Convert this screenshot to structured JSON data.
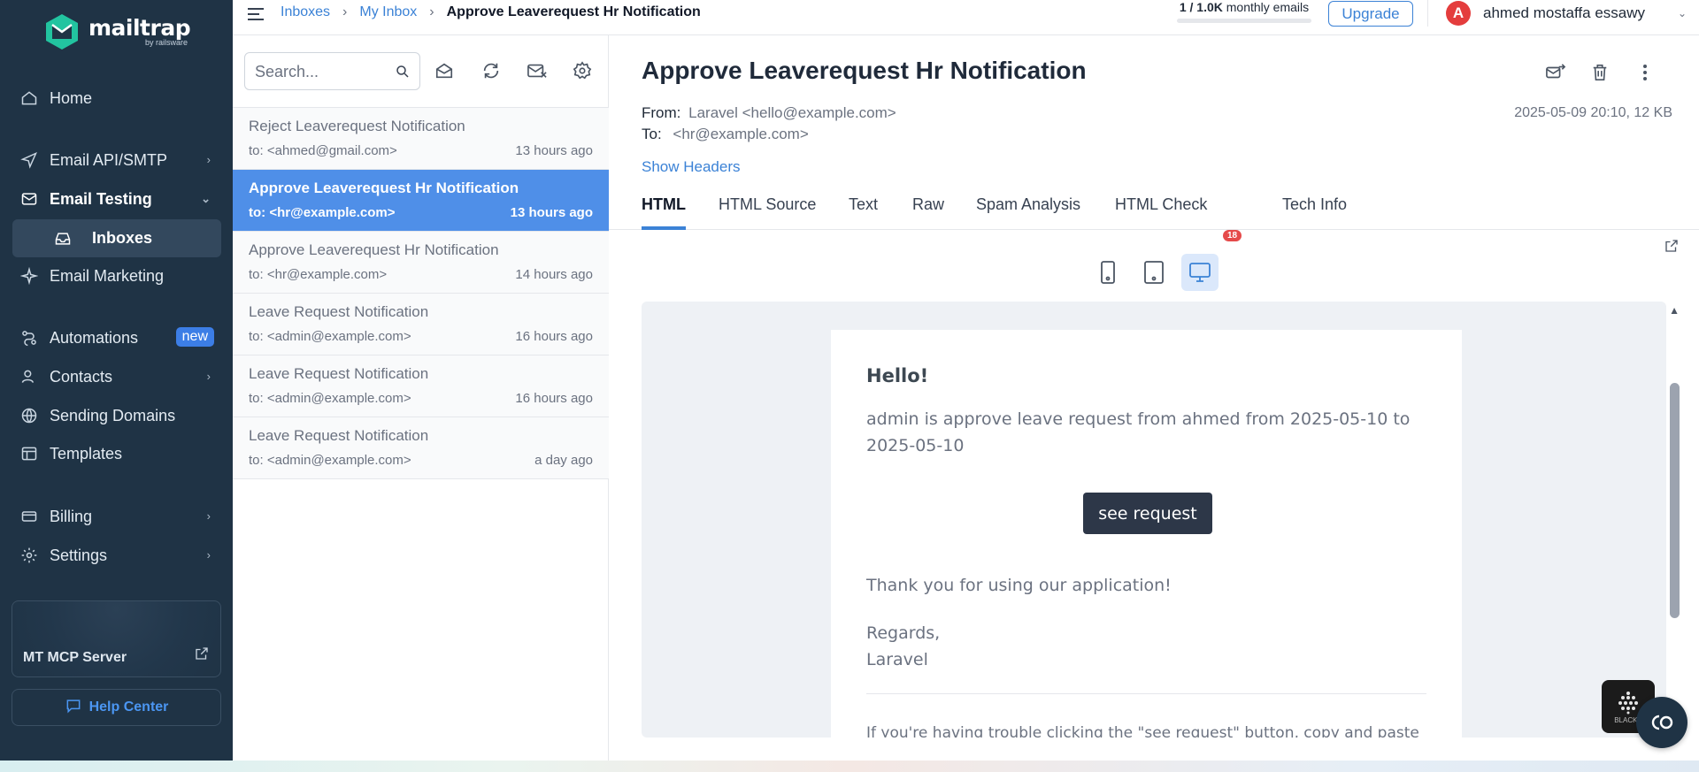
{
  "brand": {
    "name": "mailtrap",
    "sub": "by railsware",
    "color": "#1f3345",
    "accent": "#3b82d6"
  },
  "sidebar": {
    "items": [
      {
        "label": "Home",
        "icon": "home-icon"
      },
      {
        "label": "Email API/SMTP",
        "icon": "send-icon"
      },
      {
        "label": "Email Testing",
        "icon": "email-testing-icon"
      },
      {
        "label": "Inboxes",
        "icon": "inbox-icon"
      },
      {
        "label": "Email Marketing",
        "icon": "sparkle-icon"
      },
      {
        "label": "Automations",
        "icon": "automation-icon",
        "badge": "new"
      },
      {
        "label": "Contacts",
        "icon": "contacts-icon"
      },
      {
        "label": "Sending Domains",
        "icon": "globe-icon"
      },
      {
        "label": "Templates",
        "icon": "templates-icon"
      },
      {
        "label": "Billing",
        "icon": "billing-icon"
      },
      {
        "label": "Settings",
        "icon": "settings-icon"
      }
    ],
    "mcp": {
      "title": "MT MCP Server"
    },
    "help": {
      "label": "Help Center"
    }
  },
  "topbar": {
    "breadcrumbs": [
      "Inboxes",
      "My Inbox",
      "Approve Leaverequest Hr Notification"
    ],
    "usage_value": "1 / 1.0K",
    "usage_label": "monthly emails",
    "usage_fraction": 0.001,
    "upgrade": "Upgrade",
    "avatar_initial": "A",
    "user_name": "ahmed mostaffa essawy"
  },
  "list": {
    "search_placeholder": "Search...",
    "messages": [
      {
        "subject": "Reject Leaverequest Notification",
        "to": "to: <ahmed@gmail.com>",
        "time": "13 hours ago",
        "selected": false
      },
      {
        "subject": "Approve Leaverequest Hr Notification",
        "to": "to: <hr@example.com>",
        "time": "13 hours ago",
        "selected": true
      },
      {
        "subject": "Approve Leaverequest Hr Notification",
        "to": "to: <hr@example.com>",
        "time": "14 hours ago",
        "selected": false
      },
      {
        "subject": "Leave Request Notification",
        "to": "to: <admin@example.com>",
        "time": "16 hours ago",
        "selected": false
      },
      {
        "subject": "Leave Request Notification",
        "to": "to: <admin@example.com>",
        "time": "16 hours ago",
        "selected": false
      },
      {
        "subject": "Leave Request Notification",
        "to": "to: <admin@example.com>",
        "time": "a day ago",
        "selected": false
      }
    ]
  },
  "detail": {
    "subject": "Approve Leaverequest Hr Notification",
    "from_label": "From:",
    "from_value": "Laravel <hello@example.com>",
    "to_label": "To:",
    "to_value": "<hr@example.com>",
    "date_size": "2025-05-09 20:10, 12 KB",
    "show_headers": "Show Headers",
    "tabs": [
      "HTML",
      "HTML Source",
      "Text",
      "Raw",
      "Spam Analysis",
      "HTML Check",
      "Tech Info"
    ],
    "html_check_badge": "18",
    "active_tab": "HTML"
  },
  "email": {
    "greeting": "Hello!",
    "body": "admin is approve leave request from ahmed from 2025-05-10 to 2025-05-10",
    "button": "see request",
    "thanks": "Thank you for using our application!",
    "regards": "Regards,",
    "signature": "Laravel",
    "trouble": "If you're having trouble clicking the \"see request\" button, copy and paste the URL"
  },
  "widgets": {
    "blackbox_label": "BLACKB"
  }
}
